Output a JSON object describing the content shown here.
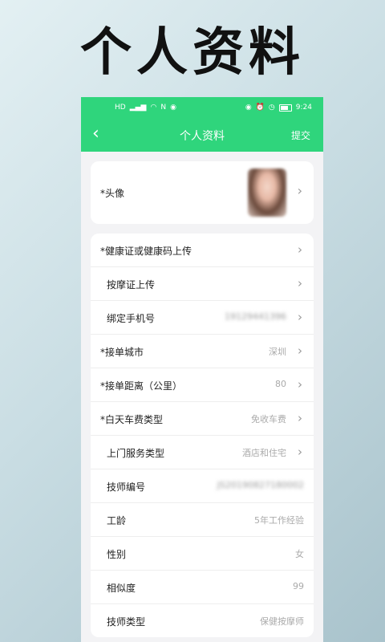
{
  "promo_title": "个人资料",
  "status_bar": {
    "time": "9:24"
  },
  "nav": {
    "back_icon": "chevron-left-icon",
    "title": "个人资料",
    "submit_label": "提交"
  },
  "avatar_row": {
    "label": "*头像"
  },
  "rows": [
    {
      "label": "*健康证或健康码上传",
      "value": "",
      "chevron": true,
      "sub": false
    },
    {
      "label": "按摩证上传",
      "value": "",
      "chevron": true,
      "sub": true
    },
    {
      "label": "绑定手机号",
      "value": "19129441396",
      "chevron": true,
      "sub": true,
      "blurred": true
    },
    {
      "label": "*接单城市",
      "value": "深圳",
      "chevron": true,
      "sub": false
    },
    {
      "label": "*接单距离（公里）",
      "value": "80",
      "chevron": true,
      "sub": false
    },
    {
      "label": "*白天车费类型",
      "value": "免收车费",
      "chevron": true,
      "sub": false
    },
    {
      "label": "上门服务类型",
      "value": "酒店和住宅",
      "chevron": true,
      "sub": true
    },
    {
      "label": "技师编号",
      "value": "JS20190827180002",
      "chevron": false,
      "sub": true,
      "blurred": true
    },
    {
      "label": "工龄",
      "value": "5年工作经验",
      "chevron": false,
      "sub": true
    },
    {
      "label": "性别",
      "value": "女",
      "chevron": false,
      "sub": true
    },
    {
      "label": "相似度",
      "value": "99",
      "chevron": false,
      "sub": true
    },
    {
      "label": "技师类型",
      "value": "保健按摩师",
      "chevron": false,
      "sub": true
    }
  ],
  "colors": {
    "brand_green": "#2fd57c",
    "background": "#f3f3f5"
  }
}
